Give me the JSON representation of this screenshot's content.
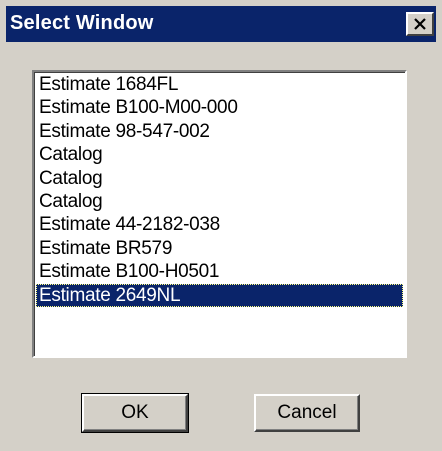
{
  "window": {
    "title": "Select Window"
  },
  "titlebar": {
    "close_icon": "close-icon"
  },
  "list": {
    "items": [
      "Estimate 1684FL",
      "Estimate B100-M00-000",
      "Estimate 98-547-002",
      "Catalog",
      "Catalog",
      "Catalog",
      "Estimate 44-2182-038",
      "Estimate BR579",
      "Estimate B100-H0501",
      "Estimate 2649NL"
    ],
    "selected_index": 9
  },
  "buttons": {
    "ok_label": "OK",
    "cancel_label": "Cancel"
  },
  "colors": {
    "titlebar": "#0a246a",
    "selection": "#0a246a",
    "face": "#d4d0c8"
  }
}
